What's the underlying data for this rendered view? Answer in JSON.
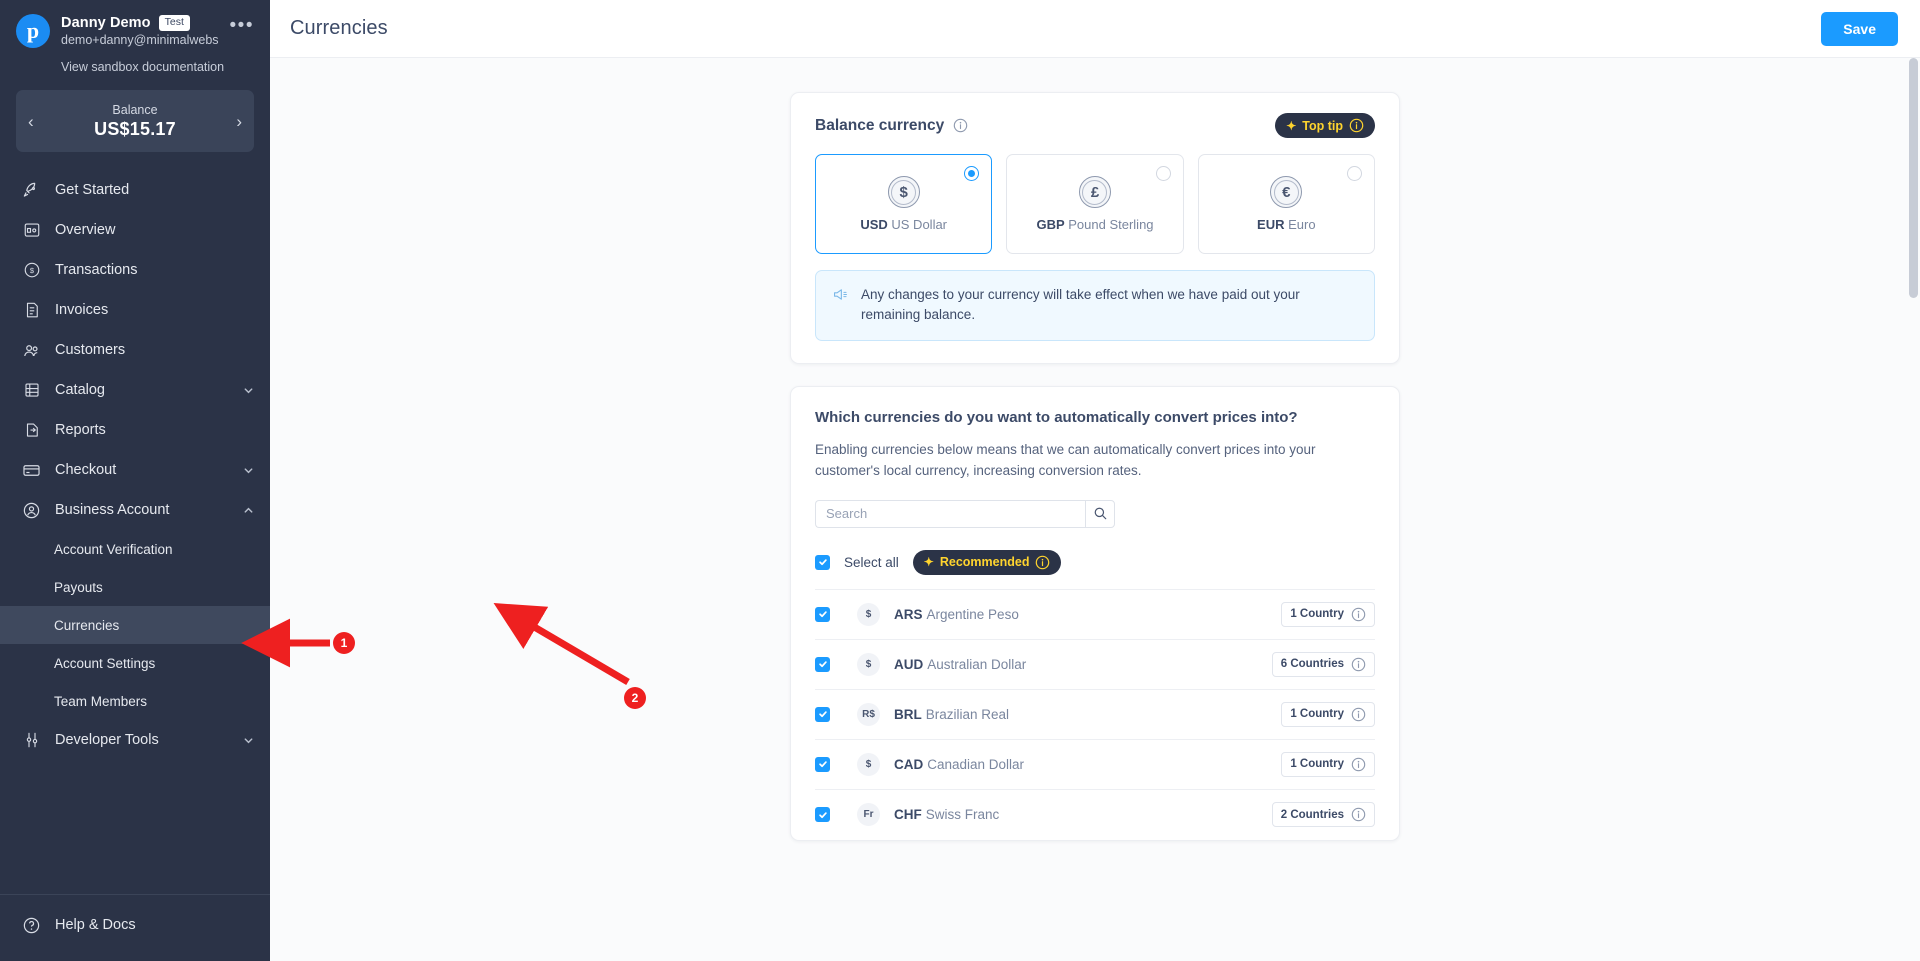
{
  "sidebar": {
    "logo_letter": "p",
    "user_name": "Danny Demo",
    "test_badge": "Test",
    "user_email": "demo+danny@minimalwebsho...",
    "doc_link": "View sandbox documentation",
    "balance_label": "Balance",
    "balance_amount": "US$15.17",
    "items": [
      {
        "label": "Get Started",
        "icon": "rocket-icon",
        "active": false,
        "chevron": ""
      },
      {
        "label": "Overview",
        "icon": "dashboard-icon",
        "active": false,
        "chevron": ""
      },
      {
        "label": "Transactions",
        "icon": "coin-icon",
        "active": false,
        "chevron": ""
      },
      {
        "label": "Invoices",
        "icon": "invoice-icon",
        "active": false,
        "chevron": ""
      },
      {
        "label": "Customers",
        "icon": "people-icon",
        "active": false,
        "chevron": ""
      },
      {
        "label": "Catalog",
        "icon": "catalog-icon",
        "active": false,
        "chevron": "down"
      },
      {
        "label": "Reports",
        "icon": "report-icon",
        "active": false,
        "chevron": ""
      },
      {
        "label": "Checkout",
        "icon": "card-icon",
        "active": false,
        "chevron": "down"
      },
      {
        "label": "Business Account",
        "icon": "account-icon",
        "active": false,
        "chevron": "up"
      }
    ],
    "sub_items": [
      {
        "label": "Account Verification",
        "active": false
      },
      {
        "label": "Payouts",
        "active": false
      },
      {
        "label": "Currencies",
        "active": true
      },
      {
        "label": "Account Settings",
        "active": false
      },
      {
        "label": "Team Members",
        "active": false
      }
    ],
    "dev_tools": {
      "label": "Developer Tools",
      "icon": "sliders-icon",
      "chevron": "down"
    },
    "help": {
      "label": "Help  &  Docs",
      "icon": "help-icon"
    }
  },
  "topbar": {
    "title": "Currencies",
    "save_label": "Save"
  },
  "balance_card": {
    "title": "Balance currency",
    "top_tip_label": "Top tip",
    "options": [
      {
        "code": "USD",
        "name": "US Dollar",
        "symbol": "$",
        "selected": true
      },
      {
        "code": "GBP",
        "name": "Pound Sterling",
        "symbol": "£",
        "selected": false
      },
      {
        "code": "EUR",
        "name": "Euro",
        "symbol": "€",
        "selected": false
      }
    ],
    "notice": "Any changes to your currency will take effect when we have paid out your remaining balance."
  },
  "convert_card": {
    "question": "Which currencies do you want to automatically convert prices into?",
    "description": "Enabling currencies below means that we can automatically convert prices into your customer's local currency, increasing conversion rates.",
    "search_placeholder": "Search",
    "search_value": "",
    "select_all_label": "Select all",
    "recommended_label": "Recommended",
    "rows": [
      {
        "symbol": "$",
        "code": "ARS",
        "name": "Argentine Peso",
        "countries": "1 Country",
        "checked": true
      },
      {
        "symbol": "$",
        "code": "AUD",
        "name": "Australian Dollar",
        "countries": "6 Countries",
        "checked": true
      },
      {
        "symbol": "R$",
        "code": "BRL",
        "name": "Brazilian Real",
        "countries": "1 Country",
        "checked": true
      },
      {
        "symbol": "$",
        "code": "CAD",
        "name": "Canadian Dollar",
        "countries": "1 Country",
        "checked": true
      },
      {
        "symbol": "Fr",
        "code": "CHF",
        "name": "Swiss Franc",
        "countries": "2 Countries",
        "checked": true
      }
    ]
  },
  "annotations": [
    {
      "number": "1"
    },
    {
      "number": "2"
    }
  ],
  "colors": {
    "sidebar_bg": "#2b3347",
    "accent_blue": "#1b9bff",
    "badge_yellow": "#ffd42e",
    "annotation_red": "#ee2020"
  }
}
